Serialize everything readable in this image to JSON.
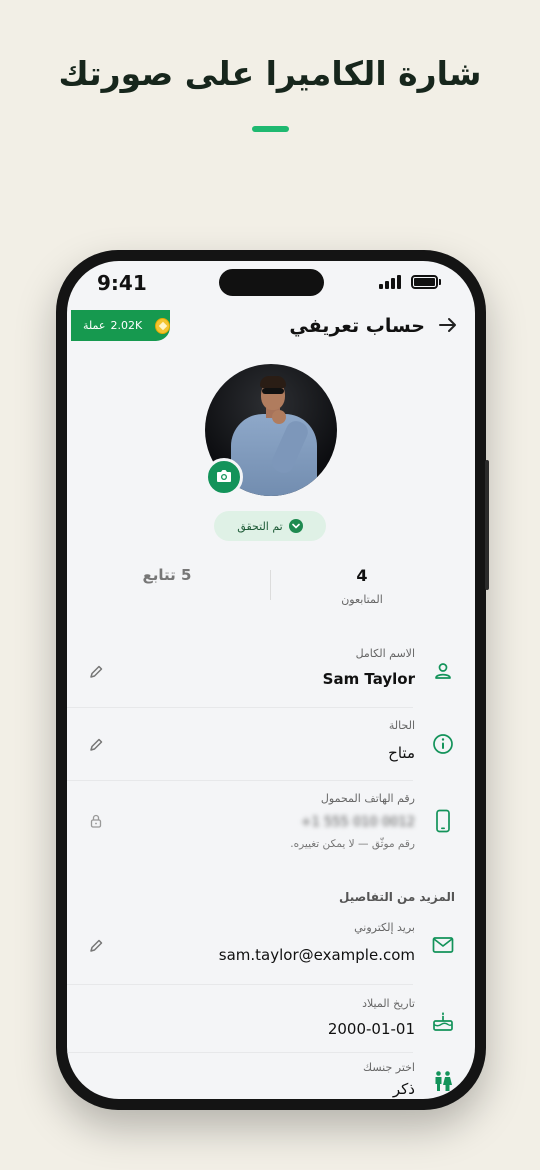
{
  "headline": "شارة الكاميرا على صورتك",
  "status_bar": {
    "time": "9:41"
  },
  "coins": {
    "amount": "2.02K",
    "label": "عملة"
  },
  "header": {
    "title": "حساب تعريفي",
    "back_icon": "arrow-right-icon"
  },
  "verified": {
    "label": "تم التحقق"
  },
  "stats": {
    "followers_count": "4",
    "followers_label": "المتابعون",
    "following_text": "5 تتابع"
  },
  "fields": {
    "full_name": {
      "label": "الاسم الكامل",
      "value": "Sam Taylor"
    },
    "status": {
      "label": "الحالة",
      "value": "متاح"
    },
    "phone": {
      "label": "رقم الهاتف المحمول",
      "value": "+1 555 010 0012",
      "note": "رقم موثّق — لا يمكن تغييره."
    },
    "more_details_title": "المزيد من التفاصيل",
    "email": {
      "label": "بريد إلكتروني",
      "value": "sam.taylor@example.com"
    },
    "birthday": {
      "label": "تاريخ الميلاد",
      "value": "2000-01-01"
    },
    "gender": {
      "label": "اختر جنسك",
      "value": "ذكر"
    }
  },
  "colors": {
    "accent": "#16994f",
    "brand_green": "#13935a",
    "background": "#f2efe6",
    "screen": "#f4f5f7"
  }
}
